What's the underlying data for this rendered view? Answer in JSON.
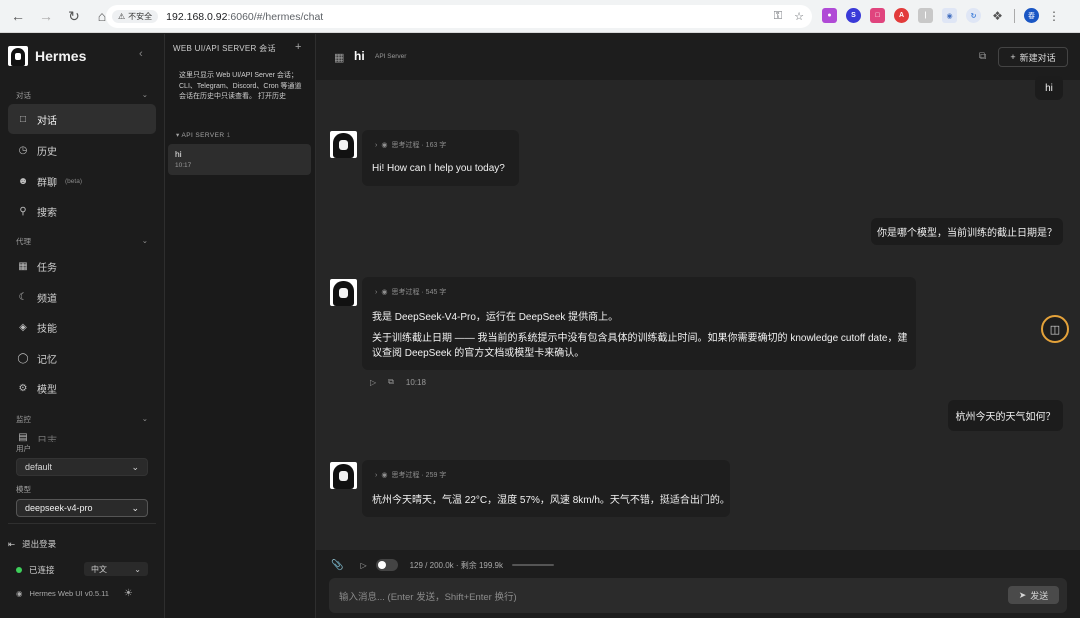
{
  "browser": {
    "security_label": "不安全",
    "url_host": "192.168.0.92",
    "url_path": ":6060/#/hermes/chat",
    "profile_initial": "春"
  },
  "sidebar": {
    "brand": "Hermes",
    "section_chat": "对话",
    "section_agent": "代理",
    "section_monitor": "监控",
    "items": [
      {
        "label": "对话",
        "icon": "chat-bubble-icon"
      },
      {
        "label": "历史",
        "icon": "clock-icon"
      },
      {
        "label": "群聊",
        "badge": "(beta)",
        "icon": "group-icon"
      },
      {
        "label": "搜索",
        "icon": "search-icon"
      },
      {
        "label": "任务",
        "icon": "calendar-icon"
      },
      {
        "label": "频道",
        "icon": "moon-icon"
      },
      {
        "label": "技能",
        "icon": "layers-icon"
      },
      {
        "label": "记忆",
        "icon": "bulb-icon"
      },
      {
        "label": "模型",
        "icon": "gear-icon"
      }
    ],
    "hidden_item": "日志",
    "user_label": "用户",
    "user_value": "default",
    "model_label": "模型",
    "model_value": "deepseek-v4-pro",
    "logout": "退出登录",
    "status": "已连接",
    "language": "中文",
    "version": "Hermes Web UI v0.5.11"
  },
  "sessions": {
    "title": "WEB UI/API SERVER 会话",
    "note": "这里只显示 Web UI/API Server 会话；CLI、Telegram、Discord、Cron 等通道会话在历史中只读查看。 打开历史",
    "group_name": "API SERVER",
    "group_count": "1",
    "items": [
      {
        "title": "hi",
        "time": "10:17"
      }
    ]
  },
  "chat": {
    "title": "hi",
    "subtitle": "API Server",
    "new_chat": "新建对话",
    "messages": [
      {
        "role": "user",
        "text": "hi"
      },
      {
        "role": "assistant",
        "thinking": "思考过程 · 163 字",
        "text": "Hi! How can I help you today?"
      },
      {
        "role": "user",
        "text": "你是哪个模型，当前训练的截止日期是？"
      },
      {
        "role": "assistant",
        "thinking": "思考过程 · 545 字",
        "p1": "我是 DeepSeek-V4-Pro，运行在 DeepSeek 提供商上。",
        "p2a": "关于训练截止日期 —— 我当前的系统提示中没有包含具体的训练截止时间。如果你需要确切的 knowledge cutoff date，建",
        "p2b": "议查阅 DeepSeek 的官方文档或模型卡来确认。",
        "time": "10:18"
      },
      {
        "role": "user",
        "text": "杭州今天的天气如何？"
      },
      {
        "role": "assistant",
        "thinking": "思考过程 · 259 字",
        "text": "杭州今天晴天，气温 22°C，湿度 57%，风速 8km/h。天气不错，挺适合出门的。"
      }
    ]
  },
  "composer": {
    "tokens": "129 / 200.0k · 剩余 199.9k",
    "placeholder": "输入消息... (Enter 发送，Shift+Enter 换行)",
    "send": "发送"
  },
  "colors": {
    "accent_ring": "#e4a23a",
    "status_green": "#3ecf5a"
  }
}
